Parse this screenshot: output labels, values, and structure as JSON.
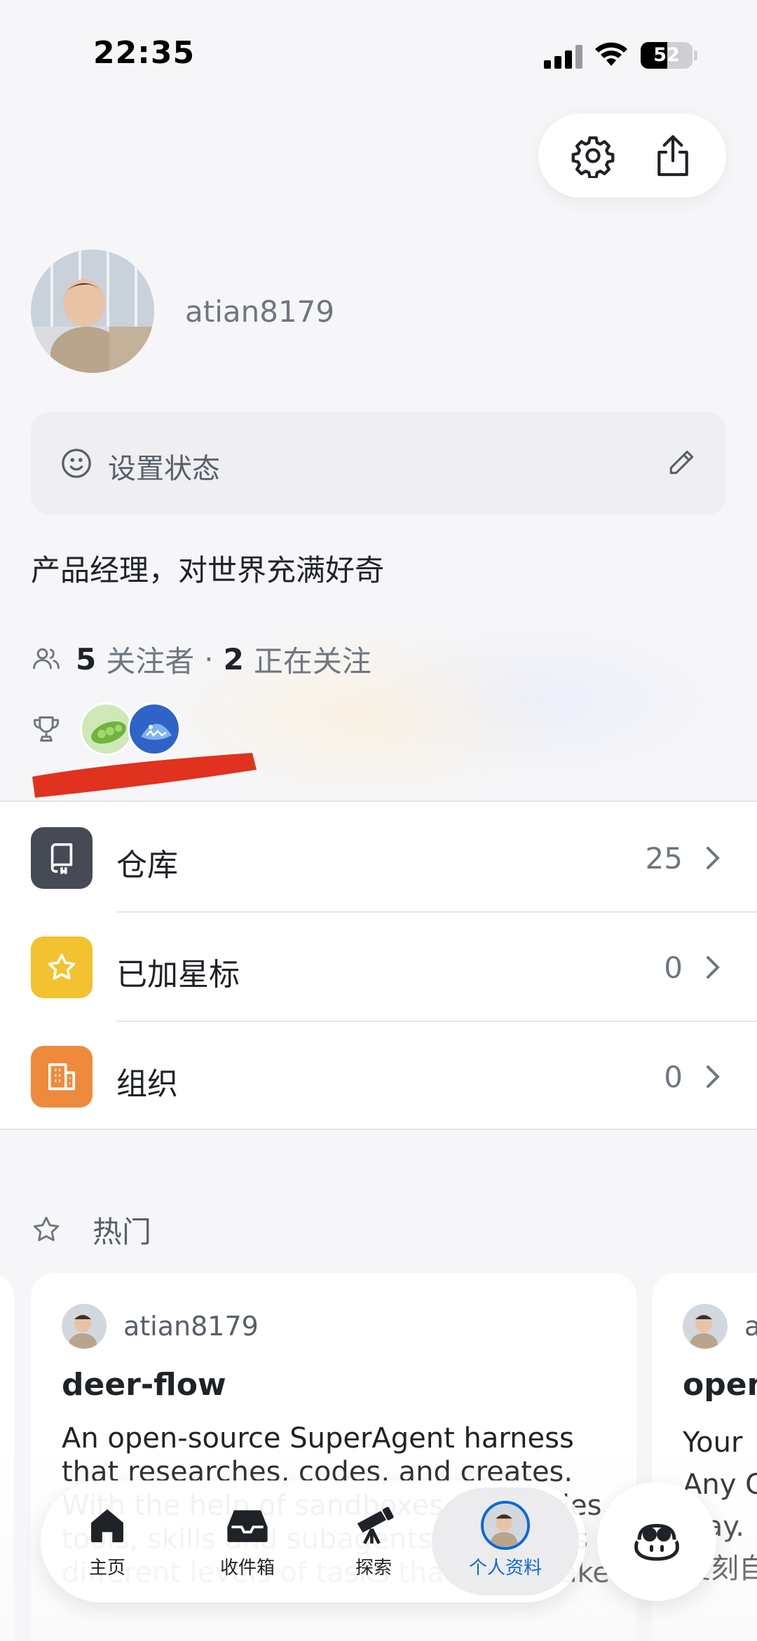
{
  "status_bar": {
    "time": "22:35",
    "battery": "52",
    "battery_level": 0.52
  },
  "profile": {
    "username": "atian8179",
    "status_placeholder": "设置状态",
    "bio": "产品经理，对世界充满好奇",
    "followers_count": "5",
    "followers_label": "关注者",
    "separator": "·",
    "following_count": "2",
    "following_label": "正在关注"
  },
  "list": [
    {
      "label": "仓库",
      "count": "25",
      "icon": "repo-icon",
      "color": "#454a55"
    },
    {
      "label": "已加星标",
      "count": "0",
      "icon": "star-icon",
      "color": "#f2c230"
    },
    {
      "label": "组织",
      "count": "0",
      "icon": "organization-icon",
      "color": "#ee8a3c"
    }
  ],
  "popular": {
    "label": "热门",
    "cards": [
      {
        "owner": "atian8179",
        "repo": "deer-flow",
        "description": "An open-source SuperAgent harness that researches, codes, and creates. With the help of sandboxes, memories, tools, skills and subagents, it handles different levels of tasks that could take"
      },
      {
        "owner": "a",
        "repo": "open",
        "description": "Your\nAny C\nway.\n复刻自"
      }
    ]
  },
  "tabbar": {
    "tabs": [
      {
        "label": "主页",
        "icon": "home-icon"
      },
      {
        "label": "收件箱",
        "icon": "inbox-icon"
      },
      {
        "label": "探索",
        "icon": "telescope-icon"
      },
      {
        "label": "个人资料",
        "icon": "avatar-icon",
        "active": true
      }
    ]
  },
  "colors": {
    "accent": "#0969da",
    "redaction": "#e0321e"
  }
}
